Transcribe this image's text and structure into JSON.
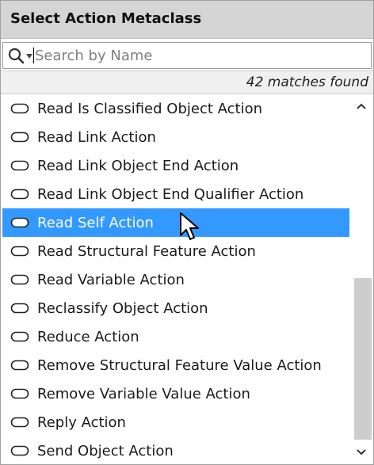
{
  "dialog": {
    "title": "Select Action Metaclass"
  },
  "search": {
    "placeholder": "Search by Name",
    "value": "",
    "icon": "search-icon"
  },
  "results": {
    "count_text": "42 matches found"
  },
  "list": {
    "item_icon": "action-metaclass-icon",
    "selected_index": 4,
    "items": [
      {
        "label": "Read Is Classified Object Action"
      },
      {
        "label": "Read Link Action"
      },
      {
        "label": "Read Link Object End Action"
      },
      {
        "label": "Read Link Object End Qualifier Action"
      },
      {
        "label": "Read Self Action"
      },
      {
        "label": "Read Structural Feature Action"
      },
      {
        "label": "Read Variable Action"
      },
      {
        "label": "Reclassify Object Action"
      },
      {
        "label": "Reduce Action"
      },
      {
        "label": "Remove Structural Feature Value Action"
      },
      {
        "label": "Remove Variable Value Action"
      },
      {
        "label": "Reply Action"
      },
      {
        "label": "Send Object Action"
      }
    ]
  },
  "colors": {
    "selection": "#3399ff",
    "title_bar": "#d5d5d5",
    "scroll_thumb": "#cdcdcd"
  }
}
